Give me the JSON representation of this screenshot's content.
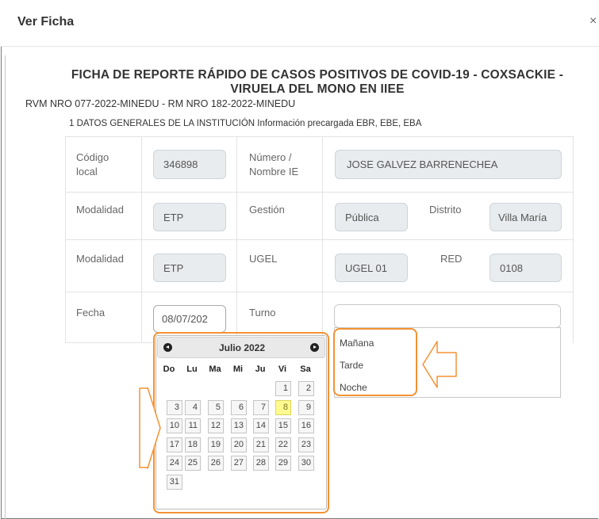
{
  "modal": {
    "title": "Ver Ficha",
    "close_label": "×"
  },
  "ficha": {
    "title_line1": "FICHA DE REPORTE RÁPIDO DE CASOS POSITIVOS DE COVID-19 - COXSACKIE -",
    "title_line2": "VIRUELA DEL MONO EN IIEE",
    "subtitle": "RVM NRO 077-2022-MINEDU - RM NRO 182-2022-MINEDU",
    "section_title": "1 DATOS GENERALES DE LA INSTITUCIÓN Información precargada EBR, EBE, EBA"
  },
  "form": {
    "codigo_local": {
      "label_line1": "Código",
      "label_line2": "local",
      "value": "346898"
    },
    "numero_nombre": {
      "label_line1": "Número /",
      "label_line2": "Nombre IE",
      "value": "JOSE GALVEZ BARRENECHEA"
    },
    "modalidad1": {
      "label": "Modalidad",
      "value": "ETP"
    },
    "gestion": {
      "label": "Gestión",
      "value": "Pública"
    },
    "distrito": {
      "label": "Distrito",
      "value": "Villa María"
    },
    "modalidad2": {
      "label": "Modalidad",
      "value": "ETP"
    },
    "ugel": {
      "label": "UGEL",
      "value": "UGEL 01"
    },
    "red": {
      "label": "RED",
      "value": "0108"
    },
    "fecha": {
      "label": "Fecha",
      "value": "08/07/202"
    },
    "turno": {
      "label": "Turno",
      "value": "",
      "options": [
        "Mañana",
        "Tarde",
        "Noche"
      ]
    }
  },
  "calendar": {
    "month_label": "Julio 2022",
    "weekdays": [
      "Do",
      "Lu",
      "Ma",
      "Mi",
      "Ju",
      "Vi",
      "Sa"
    ],
    "first_weekday_index": 5,
    "days_in_month": 31,
    "selected_day": 8
  },
  "colors": {
    "highlight": "#f39233",
    "today": "#fffa90"
  },
  "icons": {
    "prev": "chevron-left-circle-icon",
    "next": "chevron-right-circle-icon",
    "pointer_left": "arrow-left-icon",
    "pointer_right": "arrow-right-icon"
  }
}
